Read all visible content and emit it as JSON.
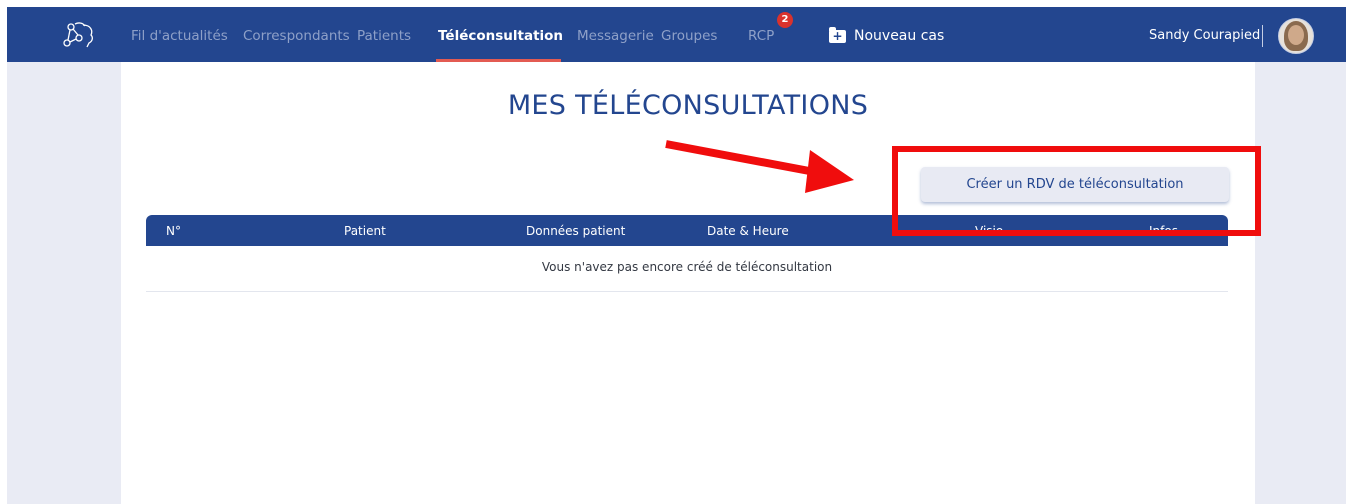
{
  "nav": {
    "items": [
      {
        "label": "Fil d'actualités"
      },
      {
        "label": "Correspondants"
      },
      {
        "label": "Patients"
      },
      {
        "label": "Téléconsultation"
      },
      {
        "label": "Messagerie"
      },
      {
        "label": "Groupes"
      },
      {
        "label": "RCP"
      }
    ],
    "rcp_badge": "2",
    "new_case_label": "Nouveau cas",
    "active": "Téléconsultation",
    "user_name": "Sandy Courapied"
  },
  "page": {
    "title": "MES TÉLÉCONSULTATIONS",
    "create_button_label": "Créer un RDV de téléconsultation"
  },
  "table": {
    "columns": [
      "N°",
      "Patient",
      "Données patient",
      "Date & Heure",
      "Visio",
      "Infos"
    ],
    "empty_message": "Vous n'avez pas encore créé de téléconsultation"
  },
  "colors": {
    "navbar": "#23468f",
    "active_underline": "#e35b52",
    "badge": "#d9322d",
    "annotation": "#f00d0d",
    "background": "#e9ebf4"
  },
  "icons": [
    "network-logo-icon",
    "folder-plus-icon",
    "avatar"
  ]
}
